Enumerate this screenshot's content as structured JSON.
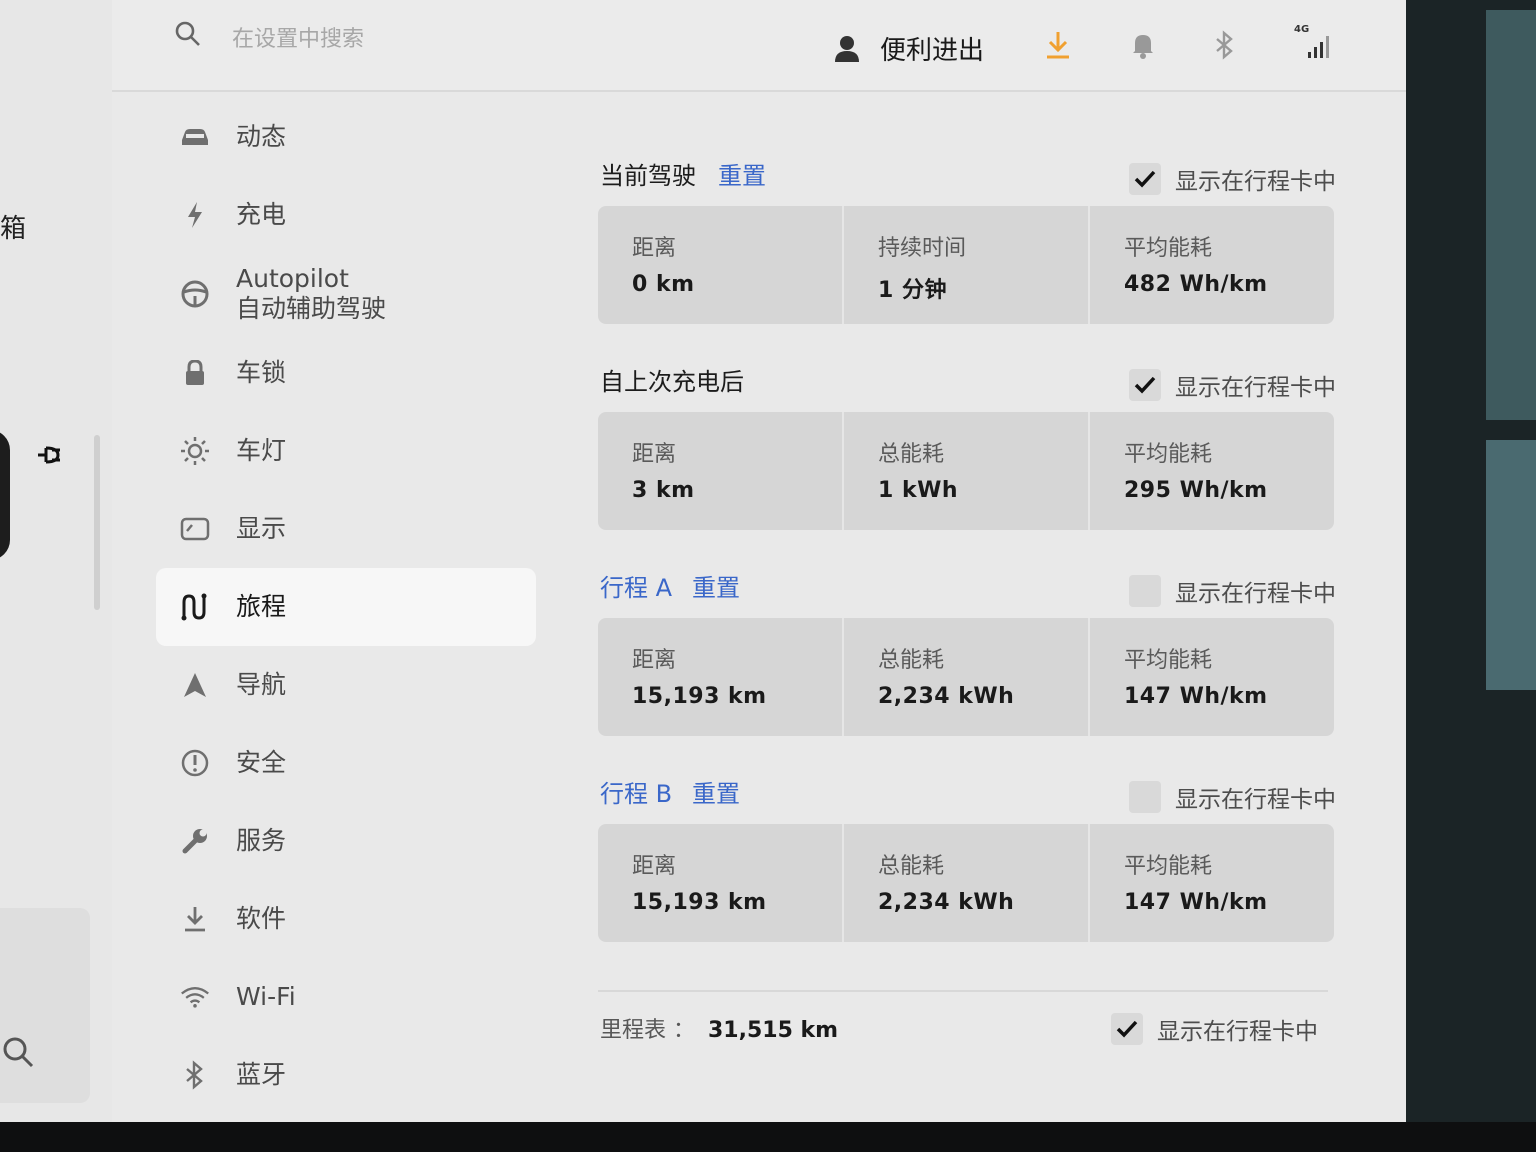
{
  "left_edge": {
    "label": "箱"
  },
  "search": {
    "placeholder": "在设置中搜索"
  },
  "profile": {
    "name": "便利进出"
  },
  "status": {
    "network": "4G",
    "accent_color": "#f0a030"
  },
  "sidebar": {
    "items": [
      {
        "label": "动态",
        "icon": "car-icon"
      },
      {
        "label": "充电",
        "icon": "lightning-icon"
      },
      {
        "label": "Autopilot",
        "label2": "自动辅助驾驶",
        "icon": "steering-wheel-icon"
      },
      {
        "label": "车锁",
        "icon": "lock-icon"
      },
      {
        "label": "车灯",
        "icon": "sun-icon"
      },
      {
        "label": "显示",
        "icon": "display-icon"
      },
      {
        "label": "旅程",
        "icon": "trips-icon",
        "active": true
      },
      {
        "label": "导航",
        "icon": "navigation-icon"
      },
      {
        "label": "安全",
        "icon": "alert-icon"
      },
      {
        "label": "服务",
        "icon": "wrench-icon"
      },
      {
        "label": "软件",
        "icon": "download-icon"
      },
      {
        "label": "Wi-Fi",
        "icon": "wifi-icon"
      },
      {
        "label": "蓝牙",
        "icon": "bluetooth-icon"
      }
    ]
  },
  "sections": [
    {
      "title": "当前驾驶",
      "reset": "重置",
      "title_blue": false,
      "show_label": "显示在行程卡中",
      "checked": true,
      "stats": [
        {
          "label": "距离",
          "value": "0  km"
        },
        {
          "label": "持续时间",
          "value": "1 分钟"
        },
        {
          "label": "平均能耗",
          "value": "482  Wh/km"
        }
      ]
    },
    {
      "title": "自上次充电后",
      "reset": "",
      "title_blue": false,
      "show_label": "显示在行程卡中",
      "checked": true,
      "stats": [
        {
          "label": "距离",
          "value": "3  km"
        },
        {
          "label": "总能耗",
          "value": "1  kWh"
        },
        {
          "label": "平均能耗",
          "value": "295  Wh/km"
        }
      ]
    },
    {
      "title": "行程 A",
      "reset": "重置",
      "title_blue": true,
      "show_label": "显示在行程卡中",
      "checked": false,
      "stats": [
        {
          "label": "距离",
          "value": "15,193  km"
        },
        {
          "label": "总能耗",
          "value": "2,234  kWh"
        },
        {
          "label": "平均能耗",
          "value": "147  Wh/km"
        }
      ]
    },
    {
      "title": "行程 B",
      "reset": "重置",
      "title_blue": true,
      "show_label": "显示在行程卡中",
      "checked": false,
      "stats": [
        {
          "label": "距离",
          "value": "15,193  km"
        },
        {
          "label": "总能耗",
          "value": "2,234  kWh"
        },
        {
          "label": "平均能耗",
          "value": "147  Wh/km"
        }
      ]
    }
  ],
  "odometer": {
    "label": "里程表 ：",
    "value": "31,515  km",
    "show_label": "显示在行程卡中",
    "checked": true
  }
}
